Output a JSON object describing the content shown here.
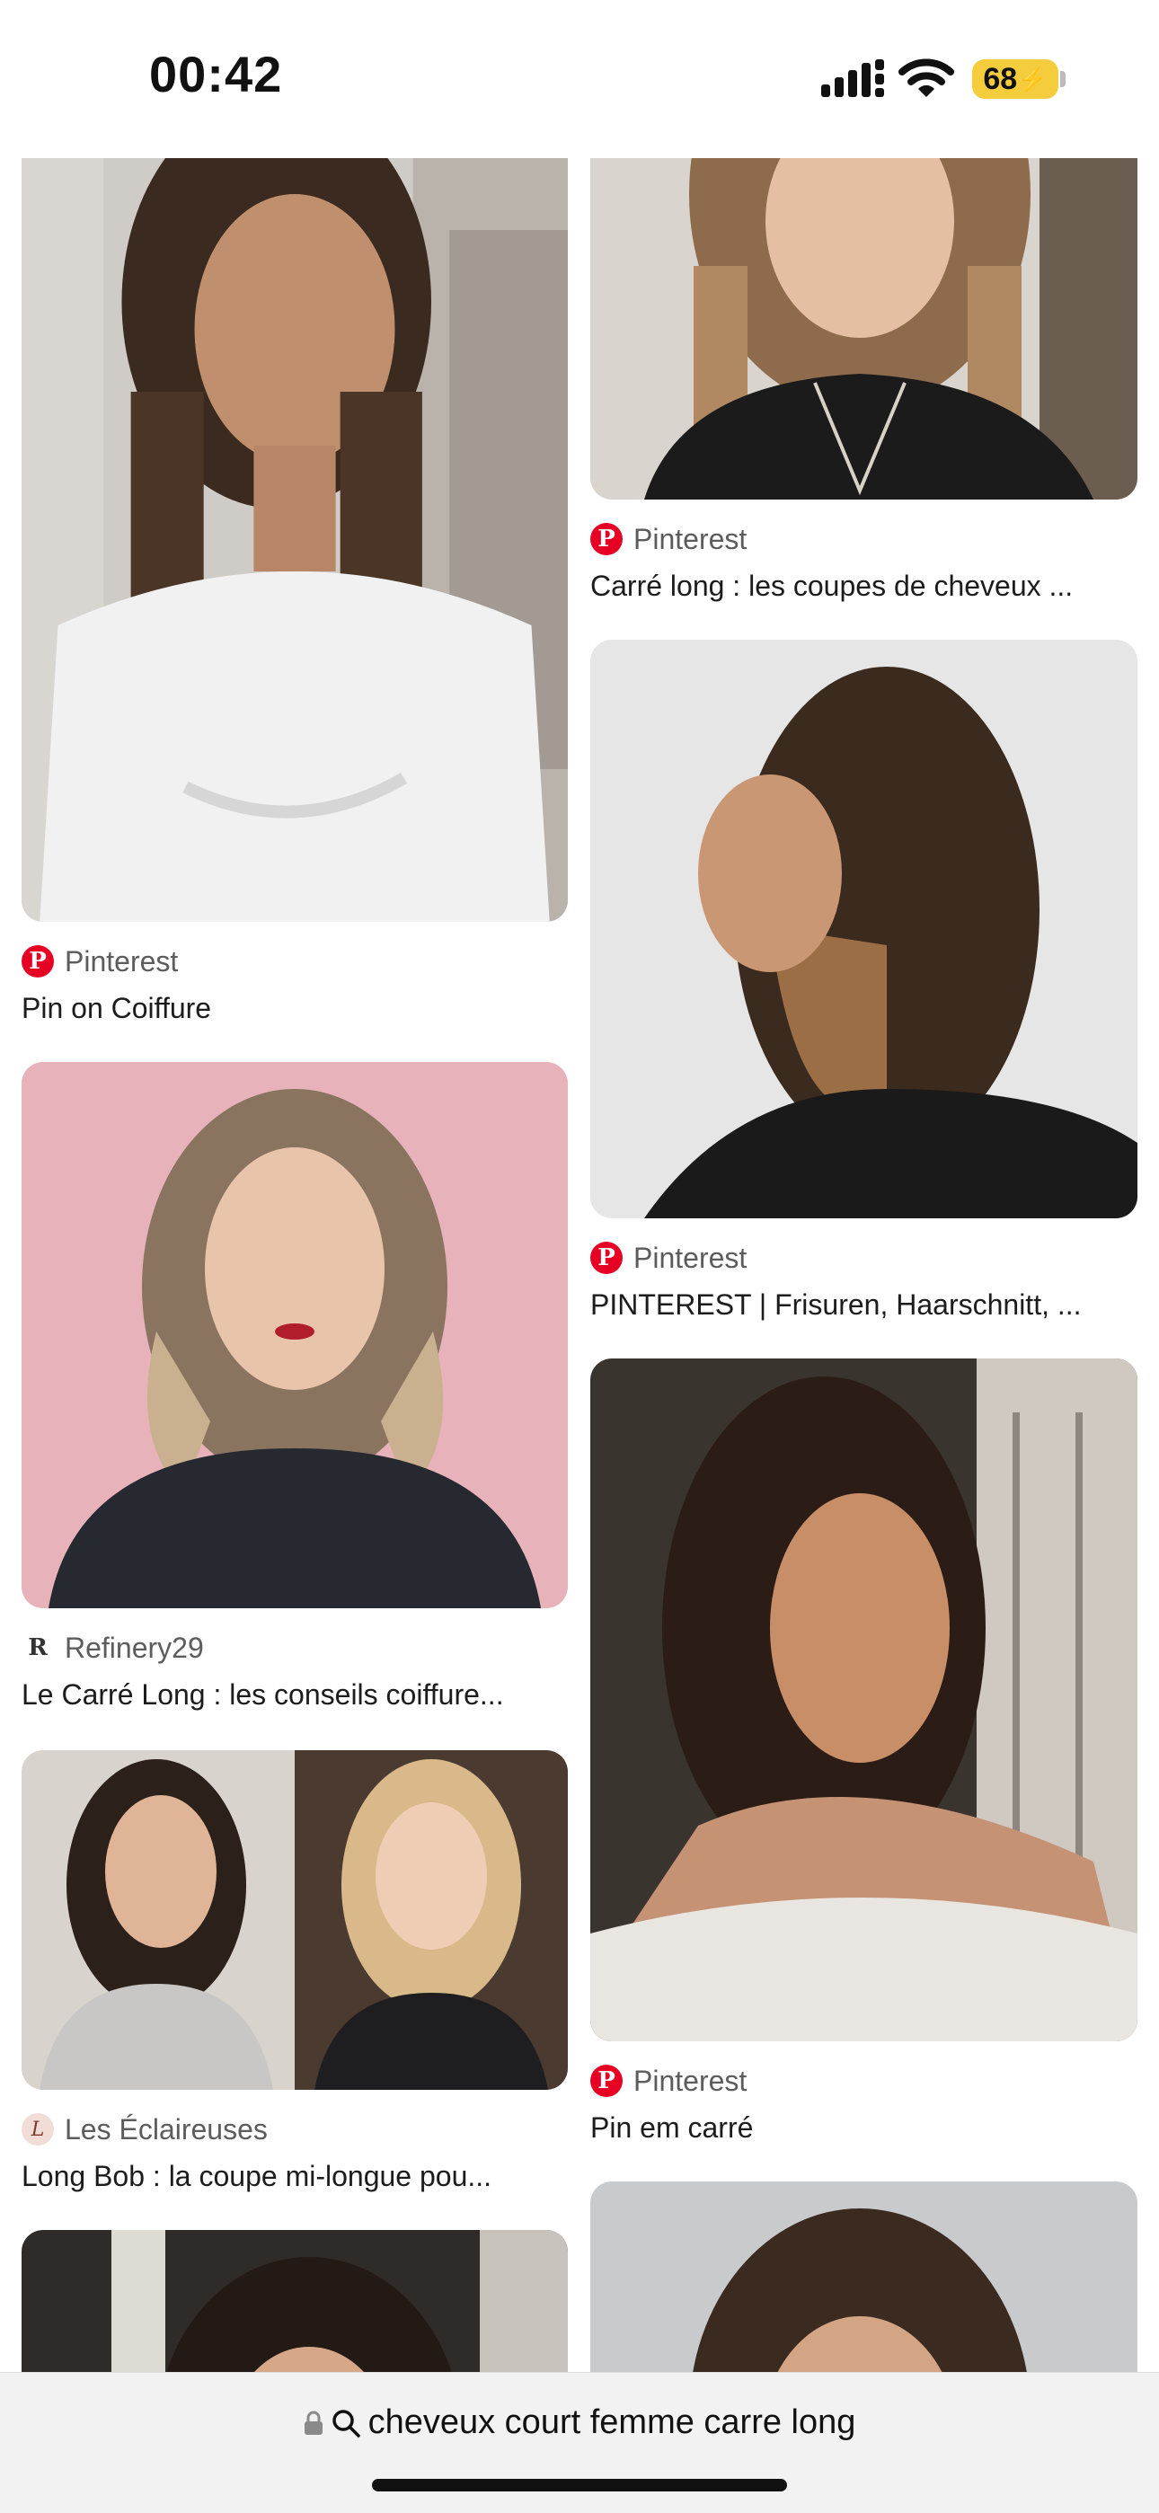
{
  "status": {
    "time": "00:42",
    "battery": "68"
  },
  "left_column": [
    {
      "source": "Pinterest",
      "source_icon": "pinterest-icon",
      "title": "Pin on Coiffure"
    },
    {
      "source": "Refinery29",
      "source_icon": "refinery29-icon",
      "title": "Le Carré Long : les conseils coiffure..."
    },
    {
      "source": "Les Éclaireuses",
      "source_icon": "les-eclaireuses-icon",
      "title": "Long Bob : la coupe mi-longue pou..."
    }
  ],
  "right_column": [
    {
      "source": "Pinterest",
      "source_icon": "pinterest-icon",
      "title": "Carré long : les coupes de cheveux ..."
    },
    {
      "source": "Pinterest",
      "source_icon": "pinterest-icon",
      "title": "PINTEREST | Frisuren, Haarschnitt, ..."
    },
    {
      "source": "Pinterest",
      "source_icon": "pinterest-icon",
      "title": "Pin em carré"
    }
  ],
  "address_bar": {
    "query": "cheveux court femme carre long"
  },
  "colors": {
    "pinterest": "#e60023",
    "battery": "#f5cd3c"
  }
}
